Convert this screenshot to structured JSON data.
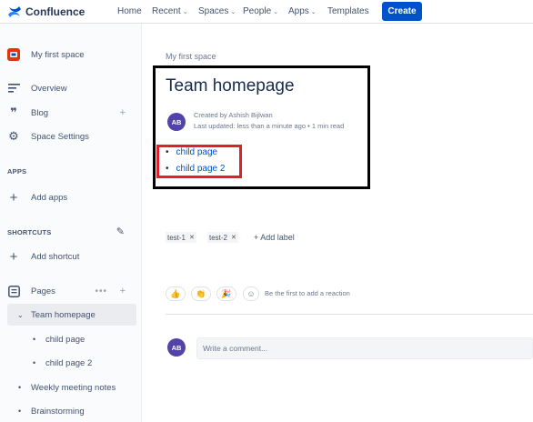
{
  "topnav": {
    "brand": "Confluence",
    "items": [
      {
        "label": "Home",
        "has_caret": false
      },
      {
        "label": "Recent",
        "has_caret": true
      },
      {
        "label": "Spaces",
        "has_caret": true
      },
      {
        "label": "People",
        "has_caret": true
      },
      {
        "label": "Apps",
        "has_caret": true
      },
      {
        "label": "Templates",
        "has_caret": false
      }
    ],
    "create_label": "Create"
  },
  "sidebar": {
    "space_name": "My first space",
    "nav": [
      "Overview",
      "Blog",
      "Space Settings"
    ],
    "apps_heading": "APPS",
    "add_apps": "Add apps",
    "shortcuts_heading": "SHORTCUTS",
    "add_shortcut": "Add shortcut",
    "pages_label": "Pages",
    "tree": [
      {
        "label": "Team homepage",
        "level": 1,
        "active": true
      },
      {
        "label": "child page",
        "level": 2
      },
      {
        "label": "child page 2",
        "level": 2
      },
      {
        "label": "Weekly meeting notes",
        "level": 1
      },
      {
        "label": "Brainstorming",
        "level": 1
      }
    ]
  },
  "content": {
    "breadcrumb": "My first space",
    "title": "Team homepage",
    "author_initials": "AB",
    "created_by": "Created by Ashish Bijlwan",
    "last_updated": "Last updated: less than a minute ago",
    "read_time": "1 min read",
    "child_links": [
      "child page",
      "child page 2"
    ],
    "labels": [
      "test-1",
      "test-2"
    ],
    "add_label": "Add label",
    "reactions": [
      "thumbs-up",
      "clap",
      "party"
    ],
    "reaction_prompt": "Be the first to add a reaction",
    "comment_placeholder": "Write a comment..."
  },
  "colors": {
    "brand_blue": "#0052cc",
    "avatar_purple": "#5243aa",
    "highlight_red": "#e0202a",
    "frame_black": "#000000"
  }
}
